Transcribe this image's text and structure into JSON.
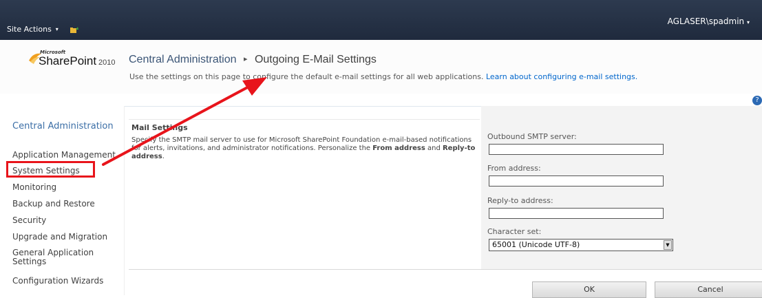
{
  "topbar": {
    "site_actions": "Site Actions",
    "site_actions_caret": "▾",
    "user": "AGLASER\\spadmin",
    "user_caret": "▾"
  },
  "logo": {
    "microsoft": "Microsoft",
    "product": "SharePoint",
    "year": "2010"
  },
  "breadcrumb": {
    "root": "Central Administration",
    "separator": "▸",
    "current": "Outgoing E-Mail Settings"
  },
  "description": {
    "text": "Use the settings on this page to configure the default e-mail settings for all web applications.",
    "link": "Learn about configuring e-mail settings."
  },
  "help_label": "?",
  "leftnav": {
    "heading": "Central Administration",
    "items": [
      "Application Management",
      "System Settings",
      "Monitoring",
      "Backup and Restore",
      "Security",
      "Upgrade and Migration",
      "General Application Settings",
      "Configuration Wizards"
    ]
  },
  "mail_settings": {
    "title": "Mail Settings",
    "body_1": "Specify the SMTP mail server to use for Microsoft SharePoint Foundation e-mail-based notifications for alerts, invitations, and administrator notifications. Personalize the ",
    "from_bold": "From address",
    "and": " and ",
    "reply_bold": "Reply-to address",
    "period": "."
  },
  "form": {
    "smtp_label": "Outbound SMTP server:",
    "smtp_value": "",
    "from_label": "From address:",
    "from_value": "",
    "reply_label": "Reply-to address:",
    "reply_value": "",
    "charset_label": "Character set:",
    "charset_value": "65001 (Unicode UTF-8)"
  },
  "buttons": {
    "ok": "OK",
    "cancel": "Cancel"
  },
  "colors": {
    "ribbon": "#1f2a3d",
    "link": "#0066cc",
    "annotation": "#e8141b"
  }
}
